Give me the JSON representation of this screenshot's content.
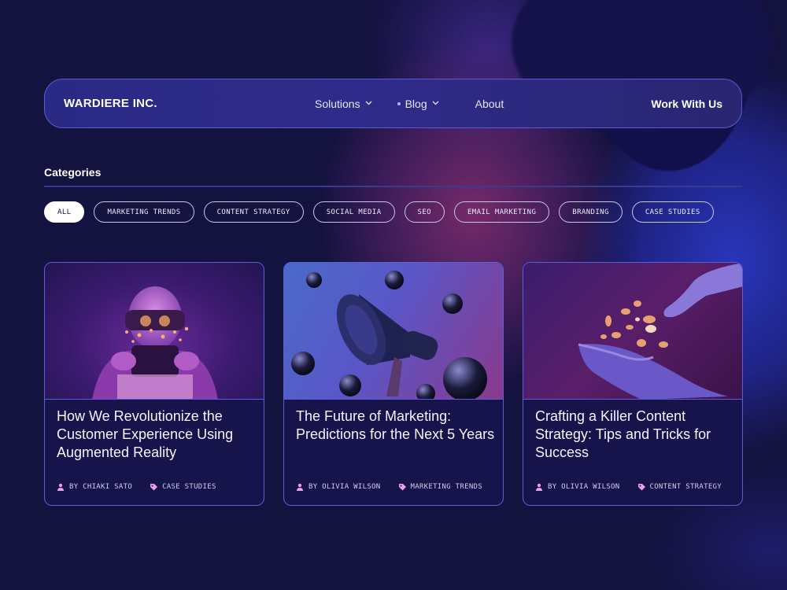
{
  "nav": {
    "brand": "WARDIERE INC.",
    "links": [
      {
        "label": "Solutions"
      },
      {
        "label": "Blog"
      },
      {
        "label": "About"
      }
    ],
    "cta": "Work With Us"
  },
  "categories": {
    "heading": "Categories",
    "chips": [
      "ALL",
      "MARKETING TRENDS",
      "CONTENT STRATEGY",
      "SOCIAL MEDIA",
      "SEO",
      "EMAIL MARKETING",
      "BRANDING",
      "CASE STUDIES"
    ],
    "active": "ALL"
  },
  "cards": [
    {
      "title": "How We Revolutionize the Customer Experience Using Augmented Reality",
      "author": "BY CHIAKI SATO",
      "tag": "CASE STUDIES",
      "image_icon": "vr-headset-icon"
    },
    {
      "title": "The Future of Marketing: Predictions for the Next 5 Years",
      "author": "BY OLIVIA WILSON",
      "tag": "MARKETING TRENDS",
      "image_icon": "megaphone-icon"
    },
    {
      "title": "Crafting a Killer Content Strategy: Tips and Tricks for Success",
      "author": "BY OLIVIA WILSON",
      "tag": "CONTENT STRATEGY",
      "image_icon": "coins-hand-icon"
    }
  ],
  "colors": {
    "background": "#14123f",
    "nav_border": "#5a5cd0",
    "card_border": "#5b5fd6",
    "meta_icon": "#e8a0e8"
  }
}
